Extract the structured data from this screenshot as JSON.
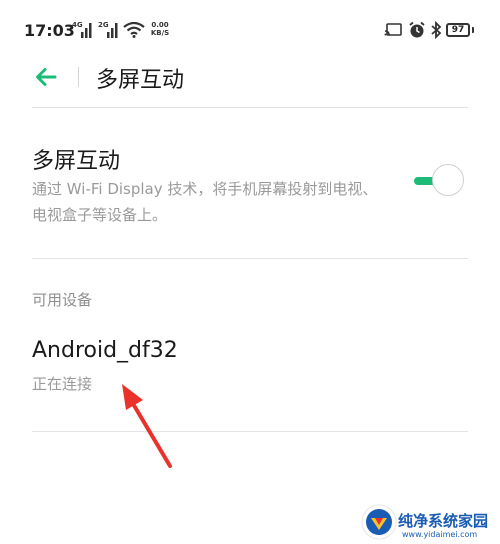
{
  "status_bar": {
    "time": "17:03",
    "signal1_label": "4G",
    "signal2_label": "2G",
    "net_speed_value": "0.00",
    "net_speed_unit": "KB/S",
    "battery": "97",
    "icons": [
      "signal-icon",
      "signal-icon",
      "wifi-icon",
      "cast-icon",
      "alarm-icon",
      "bluetooth-icon",
      "battery-icon"
    ]
  },
  "header": {
    "title": "多屏互动",
    "back_icon": "arrow-left-icon"
  },
  "setting": {
    "title": "多屏互动",
    "description": "通过 Wi-Fi Display 技术，将手机屏幕投射到电视、电视盒子等设备上。",
    "enabled": true
  },
  "devices": {
    "section_label": "可用设备",
    "items": [
      {
        "name": "Android_df32",
        "status": "正在连接"
      }
    ]
  },
  "watermark": {
    "text": "纯净系统家园",
    "url": "www.yidaimei.com"
  },
  "colors": {
    "accent": "#1dbb78",
    "annotation_arrow": "#e8322b",
    "watermark": "#1a5bb4"
  }
}
